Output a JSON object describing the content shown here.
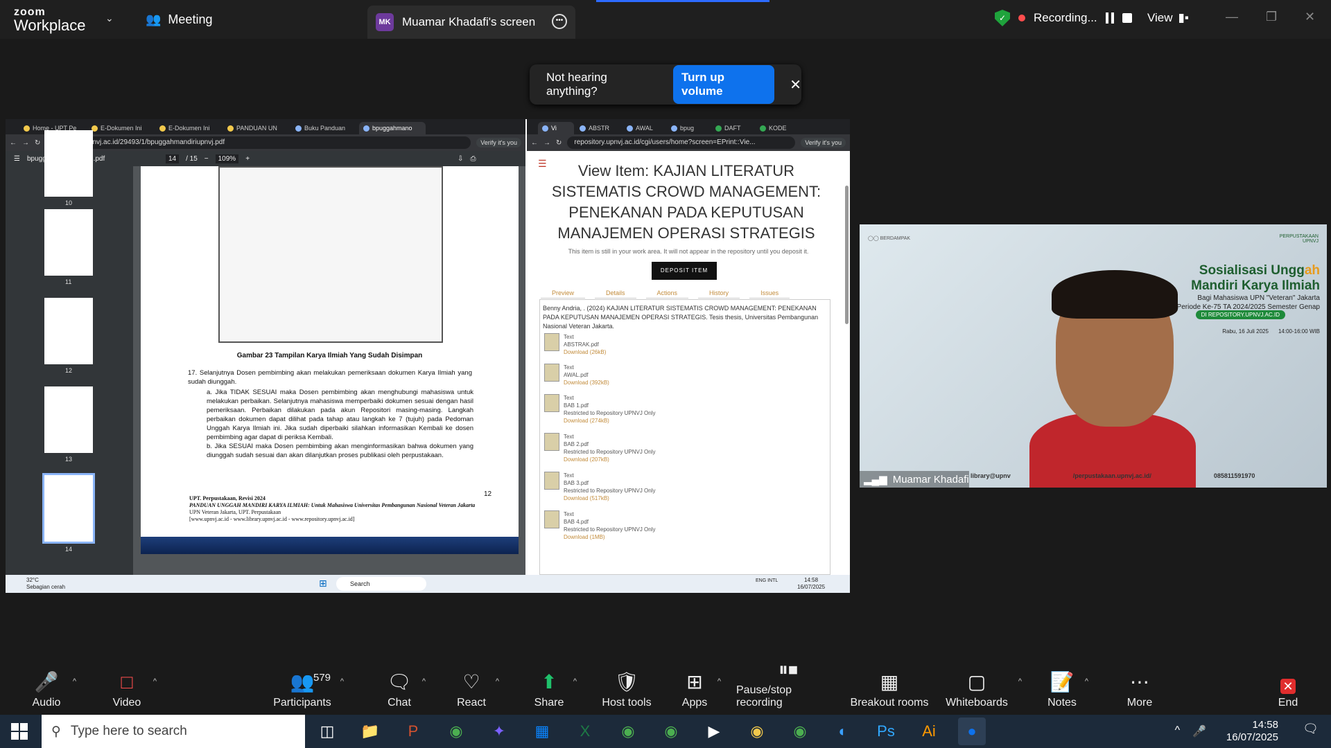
{
  "zoom": {
    "logo_top": "zoom",
    "logo_bottom": "Workplace",
    "meeting_label": "Meeting",
    "shared_screen_label": "Muamar Khadafi's screen",
    "presenter_initials": "MK",
    "recording_label": "Recording...",
    "view_label": "View"
  },
  "toast": {
    "message": "Not hearing anything?",
    "button": "Turn up volume"
  },
  "left_browser": {
    "tabs": [
      "Home - UPT Pe",
      "E-Dokumen Ini",
      "E-Dokumen Ini",
      "PANDUAN UN",
      "Buku Panduan",
      "bpuggahmano"
    ],
    "url": "repository.upnvj.ac.id/29493/1/bpuggahmandiriupnvj.pdf",
    "verify": "Verify it's you",
    "pdf_name": "bpuggahmandiriupnvj.pdf",
    "page_current": "14",
    "page_total": "/ 15",
    "zoom": "109%",
    "thumbnails": [
      "10",
      "11",
      "12",
      "13",
      "14"
    ]
  },
  "pdf_page": {
    "caption": "Gambar 23 Tampilan Karya Ilmiah Yang Sudah Disimpan",
    "item17": "17. Selanjutnya Dosen pembimbing akan melakukan pemeriksaan dokumen Karya Ilmiah yang sudah diunggah.",
    "item_a": "a. Jika TIDAK SESUAI maka Dosen pembimbing akan menghubungi mahasiswa untuk melakukan perbaikan. Selanjutnya mahasiswa memperbaiki dokumen sesuai dengan hasil pemeriksaan. Perbaikan dilakukan pada akun Repositori masing-masing. Langkah perbaikan dokumen dapat dilihat pada tahap atau langkah ke 7 (tujuh) pada Pedoman Unggah Karya Ilmiah ini. Jika sudah diperbaiki silahkan informasikan Kembali ke dosen pembimbing agar dapat di periksa Kembali.",
    "item_b": "b. Jika SESUAI maka Dosen pembimbing akan menginformasikan bahwa dokumen yang diunggah sudah sesuai dan akan dilanjutkan proses publikasi oleh perpustakaan.",
    "page_number": "12",
    "footer1": "UPT. Perpustakaan, Revisi 2024",
    "footer2": "PANDUAN UNGGAH MANDIRI KARYA ILMIAH: Untuk Mahasiswa Universitas Pembangunan Nasional Veteran Jakarta",
    "footer3": "UPN Veteran Jakarta, UPT. Perpustakaan",
    "footer4": "[www.upnvj.ac.id - www.library.upnvj.ac.id - www.repository.upnvj.ac.id]"
  },
  "right_browser": {
    "tabs": [
      "Vi",
      "ABSTR",
      "AWAL",
      "bpug",
      "DAFT",
      "KODE"
    ],
    "url": "repository.upnvj.ac.id/cgi/users/home?screen=EPrint::Vie...",
    "verify": "Verify it's you",
    "title": "View Item: KAJIAN LITERATUR SISTEMATIS CROWD MANAGEMENT: PENEKANAN PADA KEPUTUSAN MANAJEMEN OPERASI STRATEGIS",
    "notice": "This item is still in your work area. It will not appear in the repository until you deposit it.",
    "deposit": "DEPOSIT ITEM",
    "etabs": [
      "Preview",
      "Details",
      "Actions",
      "History",
      "Issues"
    ],
    "citation": "Benny Andria, . (2024) KAJIAN LITERATUR SISTEMATIS CROWD MANAGEMENT: PENEKANAN PADA KEPUTUSAN MANAJEMEN OPERASI STRATEGIS. Tesis thesis, Universitas Pembangunan Nasional Veteran Jakarta.",
    "files": [
      {
        "type": "Text",
        "name": "ABSTRAK.pdf",
        "restrict": "",
        "dl": "Download (26kB)"
      },
      {
        "type": "Text",
        "name": "AWAL.pdf",
        "restrict": "",
        "dl": "Download (392kB)"
      },
      {
        "type": "Text",
        "name": "BAB 1.pdf",
        "restrict": "Restricted to Repository UPNVJ Only",
        "dl": "Download (274kB)"
      },
      {
        "type": "Text",
        "name": "BAB 2.pdf",
        "restrict": "Restricted to Repository UPNVJ Only",
        "dl": "Download (207kB)"
      },
      {
        "type": "Text",
        "name": "BAB 3.pdf",
        "restrict": "Restricted to Repository UPNVJ Only",
        "dl": "Download (517kB)"
      },
      {
        "type": "Text",
        "name": "BAB 4.pdf",
        "restrict": "Restricted to Repository UPNVJ Only",
        "dl": "Download (1MB)"
      }
    ]
  },
  "shared_taskbar": {
    "weather": "32°C",
    "weather_sub": "Sebagian cerah",
    "search": "Search",
    "lang": "ENG INTL",
    "time": "14:58",
    "date": "16/07/2025"
  },
  "video": {
    "logo_text": "BERDAMPAK",
    "org_right": "PERPUSTAKAAN UPNVJ",
    "title_a": "Sosialisasi Ungg",
    "title_b": "ah",
    "title2": "Mandiri Karya Ilmiah",
    "sub1": "Bagi Mahasiswa UPN \"Veteran\" Jakarta",
    "sub2": "Wisuda Periode Ke-75 TA 2024/2025 Semester Genap",
    "pill": "DI REPOSITORY.UPNVJ.AC.ID",
    "date": "Rabu, 16 Juli 2025",
    "time": "14:00-16:00 WIB",
    "participant_name": "Muamar Khadafi",
    "email": "library@upnv",
    "web": "/perpustakaan.upnvj.ac.id/",
    "phone": "085811591970"
  },
  "toolbar": {
    "audio": "Audio",
    "video": "Video",
    "participants": "Participants",
    "participants_count": "579",
    "chat": "Chat",
    "react": "React",
    "share": "Share",
    "host_tools": "Host tools",
    "apps": "Apps",
    "pause_stop": "Pause/stop recording",
    "breakout": "Breakout rooms",
    "whiteboards": "Whiteboards",
    "notes": "Notes",
    "more": "More",
    "end": "End"
  },
  "taskbar": {
    "search_placeholder": "Type here to search",
    "time": "14:58",
    "date": "16/07/2025"
  },
  "colors": {
    "zoom_bg": "#1a1a1a",
    "accent_blue": "#0e72ed",
    "share_green": "#1fc16b",
    "end_red": "#e02d2d"
  }
}
